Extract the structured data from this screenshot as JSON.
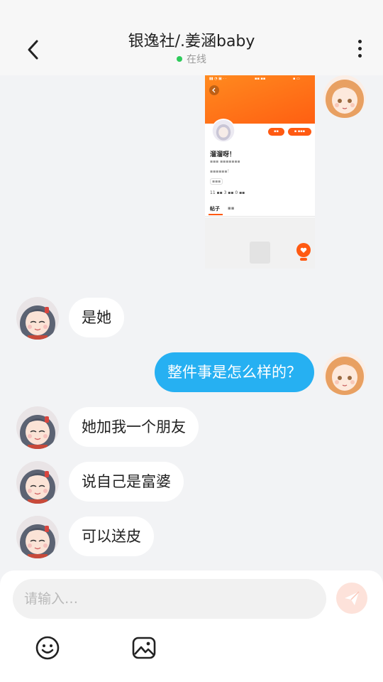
{
  "header": {
    "title": "银逸社/.姜涵baby",
    "status": "在线",
    "status_color": "#2ecb5b",
    "back_icon": "chevron-left-icon",
    "more_icon": "more-vertical-icon"
  },
  "shared_image": {
    "profile_name": "溜溜呀！",
    "tab_posts": "帖子",
    "tab_active_color": "#ff5a12",
    "brand_color": "#ff6a14"
  },
  "messages": [
    {
      "side": "left",
      "text": "是她"
    },
    {
      "side": "right",
      "text": "整件事是怎么样的？"
    },
    {
      "side": "left",
      "text": "她加我一个朋友"
    },
    {
      "side": "left",
      "text": "说自己是富婆"
    },
    {
      "side": "left",
      "text": "可以送皮"
    }
  ],
  "colors": {
    "own_bubble": "#26b0f2",
    "other_bubble": "#ffffff",
    "send_button": "#fde2da"
  },
  "composer": {
    "placeholder": "请输入…",
    "value": "",
    "send_icon": "paper-plane-icon",
    "emoji_icon": "smiley-icon",
    "image_icon": "image-icon"
  }
}
